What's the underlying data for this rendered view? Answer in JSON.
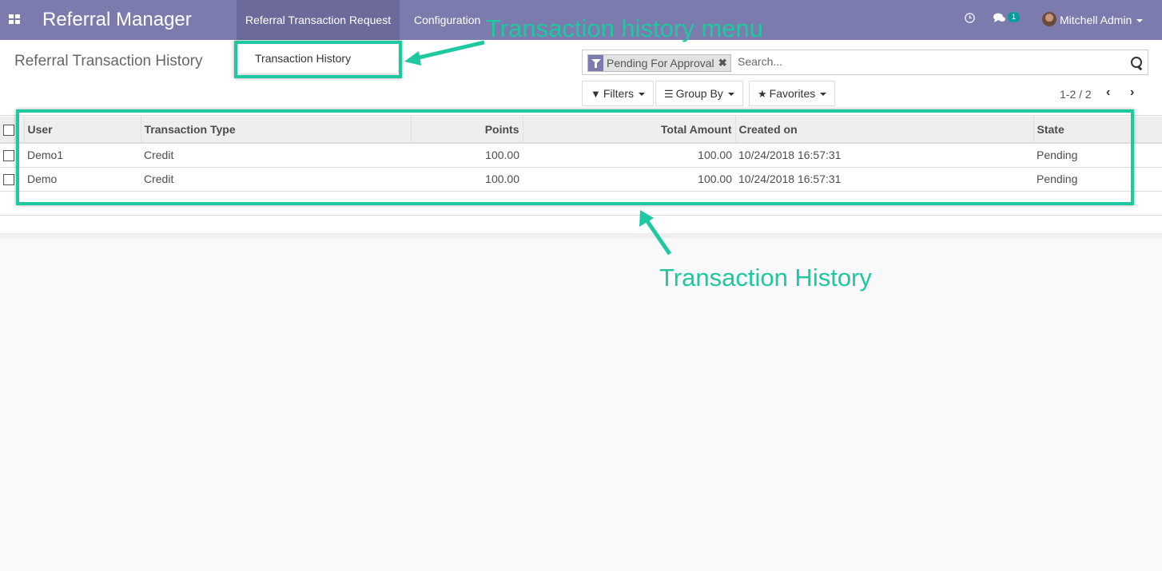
{
  "navbar": {
    "brand": "Referral Manager",
    "menu": [
      {
        "label": "Referral Transaction Request"
      },
      {
        "label": "Configuration"
      }
    ],
    "chat_badge": "1",
    "user_name": "Mitchell Admin"
  },
  "control_panel": {
    "title": "Referral Transaction History",
    "dropdown_item": "Transaction History",
    "search": {
      "facet_label": "Pending For Approval",
      "facet_remove": "✖",
      "placeholder": "Search..."
    },
    "buttons": {
      "filters": "Filters",
      "group_by": "Group By",
      "favorites": "Favorites"
    },
    "pager": "1-2 / 2",
    "pager_prev": "‹",
    "pager_next": "›"
  },
  "table": {
    "columns": [
      "User",
      "Transaction Type",
      "Points",
      "Total Amount",
      "Created on",
      "State"
    ],
    "rows": [
      {
        "user": "Demo1",
        "type": "Credit",
        "points": "100.00",
        "total": "100.00",
        "created": "10/24/2018 16:57:31",
        "state": "Pending"
      },
      {
        "user": "Demo",
        "type": "Credit",
        "points": "100.00",
        "total": "100.00",
        "created": "10/24/2018 16:57:31",
        "state": "Pending"
      }
    ]
  },
  "annotations": {
    "menu_label": "Transaction history menu",
    "table_label": "Transaction History",
    "color": "#1ec8a0"
  },
  "colors": {
    "navbar": "#7c7bad",
    "accent": "#00a09d"
  }
}
